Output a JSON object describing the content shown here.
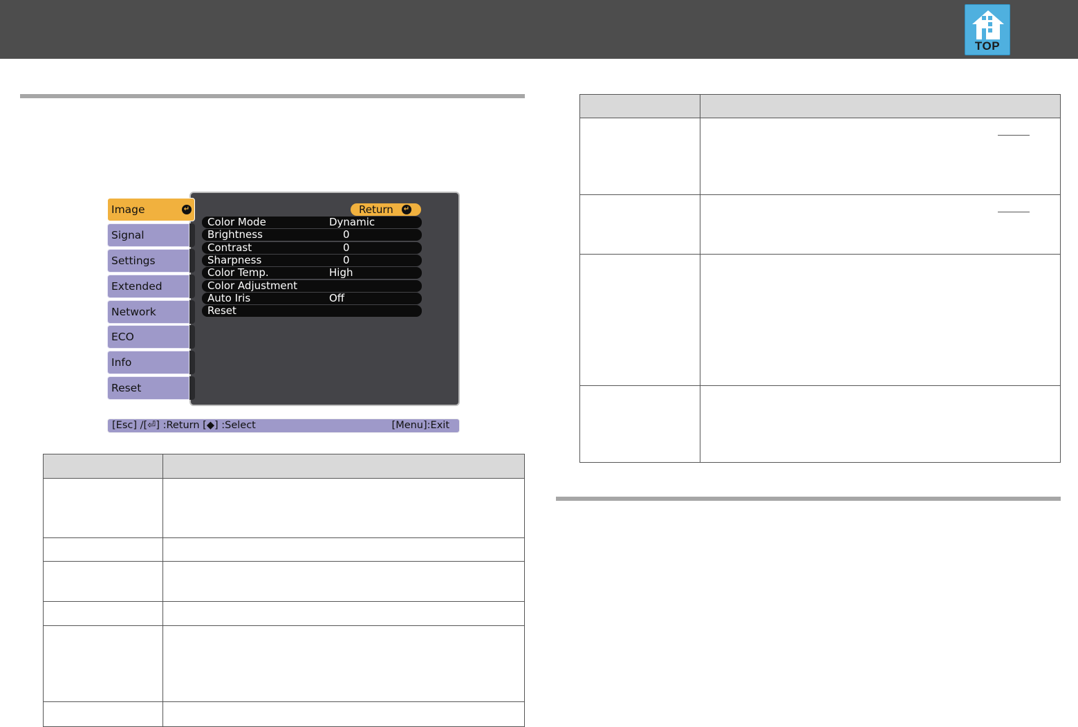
{
  "header": {
    "top_button": {
      "label": "TOP",
      "icon": "house-icon",
      "color": "#4fb0df"
    }
  },
  "menu": {
    "tabs": [
      {
        "label": "Image",
        "active": true
      },
      {
        "label": "Signal"
      },
      {
        "label": "Settings"
      },
      {
        "label": "Extended"
      },
      {
        "label": "Network"
      },
      {
        "label": "ECO"
      },
      {
        "label": "Info"
      },
      {
        "label": "Reset"
      }
    ],
    "return_label": "Return",
    "items": [
      {
        "label": "Color Mode",
        "value": "Dynamic"
      },
      {
        "label": "Brightness",
        "value": "0"
      },
      {
        "label": "Contrast",
        "value": "0"
      },
      {
        "label": "Sharpness",
        "value": "0"
      },
      {
        "label": "Color Temp.",
        "value": "High"
      },
      {
        "label": "Color Adjustment",
        "value": ""
      },
      {
        "label": "Auto Iris",
        "value": "Off"
      },
      {
        "label": "Reset",
        "value": ""
      }
    ],
    "help_left": "[Esc] /[⏎] :Return  [◆] :Select",
    "help_right": "[Menu]:Exit",
    "colors": {
      "active_tab": "#f1b13e",
      "tab": "#9e99c9",
      "panel": "#444448",
      "row": "#0c0c0c"
    }
  }
}
